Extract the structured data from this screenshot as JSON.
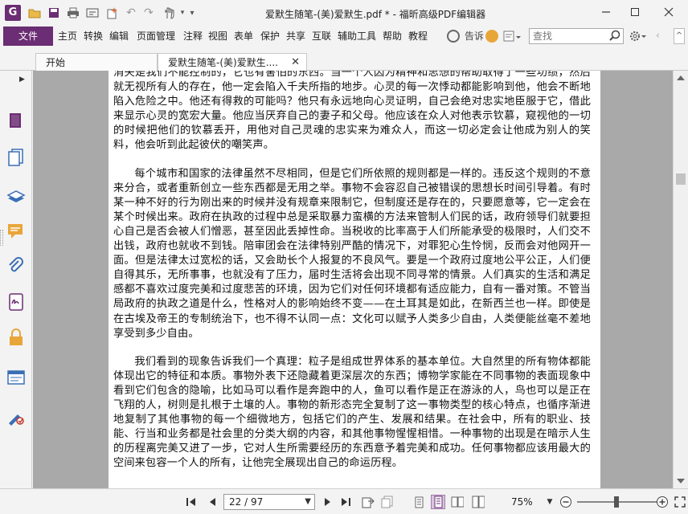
{
  "window": {
    "title": "爱默生随笔-(美)爱默生.pdf * - 福昕高级PDF编辑器"
  },
  "menu": {
    "file": "文件",
    "items": [
      "主页",
      "转换",
      "编辑",
      "页面管理",
      "注释",
      "视图",
      "表单",
      "保护",
      "共享",
      "互联",
      "辅助工具",
      "帮助",
      "教程"
    ],
    "tell_me": "告诉",
    "search_placeholder": "查找"
  },
  "tabs": [
    {
      "label": "开始",
      "active": false
    },
    {
      "label": "爱默生随笔-(美)爱默生....",
      "active": true
    }
  ],
  "document": {
    "paragraphs": [
      "消失是我们不能控制的，它也有害怕的东西。当一个人因为精神和思想的帮助取得了一些功绩，然后就无视所有人的存在，他一定会陷入千夫所指的地步。心灵的每一次悸动都能影响到他，他会不断地陷入危险之中。他还有得救的可能吗？他只有永远地向心灵证明，自己会绝对忠实地臣服于它，借此来显示心灵的宽宏大量。他应当厌弃自己的妻子和父母。他应该在众人对他表示钦慕，窥视他的一切的时候把他们的钦慕丢开，用他对自己灵魂的忠实来为难众人，而这一切必定会让他成为别人的笑料，他会听到此起彼伏的嘲笑声。",
      "每个城市和国家的法律虽然不尽相同，但是它们所依照的规则都是一样的。违反这个规则的不意来分合，或者重新创立一些东西都是无用之举。事物不会容忍自己被错误的思想长时间引导着。有时某一种不好的行为刚出来的时候并没有规章来限制它，但制度还是存在的，只要愿意等，它一定会在某个时候出来。政府在执政的过程中总是采取暴力蛮横的方法来管制人们民的话，政府领导们就要担心自己是否会被人们憎恶，甚至因此丢掉性命。当税收的比率高于人们所能承受的极限时，人们交不出钱，政府也就收不到钱。陪审团会在法律特别严酷的情况下，对罪犯心生怜悯，反而会对他网开一面。但是法律太过宽松的话，又会助长个人报复的不良风气。要是一个政府过度地公平公正，人们便自得其乐，无所事事，也就没有了压力，届时生活将会出现不同寻常的情景。人们真实的生活和满足感都不喜欢过度完美和过度悲苦的环境，因为它们对任何环境都有适应能力，自有一番对策。不管当局政府的执政之道是什么，性格对人的影响始终不变——在土耳其是如此，在新西兰也一样。即使是在古埃及帝王的专制统治下，也不得不认同一点：文化可以赋予人类多少自由，人类便能丝毫不差地享受到多少自由。",
      "我们看到的现象告诉我们一个真理：粒子是组成世界体系的基本单位。大自然里的所有物体都能体现出它的特征和本质。事物外表下还隐藏着更深层次的东西；博物学家能在不同事物的表面现象中看到它们包含的隐喻，比如马可以看作是奔跑中的人，鱼可以看作是正在游泳的人，鸟也可以是正在飞翔的人，树则是扎根于土壤的人。事物的新形态完全复制了这一事物类型的核心特点，也循序渐进地复制了其他事物的每一个细微地方，包括它们的产生、发展和结果。在社会中，所有的职业、技能、行当和业务都是社会里的分类大纲的内容，和其他事物惺惺相惜。一种事物的出现是在暗示人生的历程离完美又进了一步，它对人生所需要经历的东西意予着完美和成功。任何事物都应该用最大的空间来包容一个人的所有，让他完全展现出自己的命运历程。"
    ]
  },
  "status": {
    "page_indicator": "22 / 97",
    "zoom": "75%"
  }
}
